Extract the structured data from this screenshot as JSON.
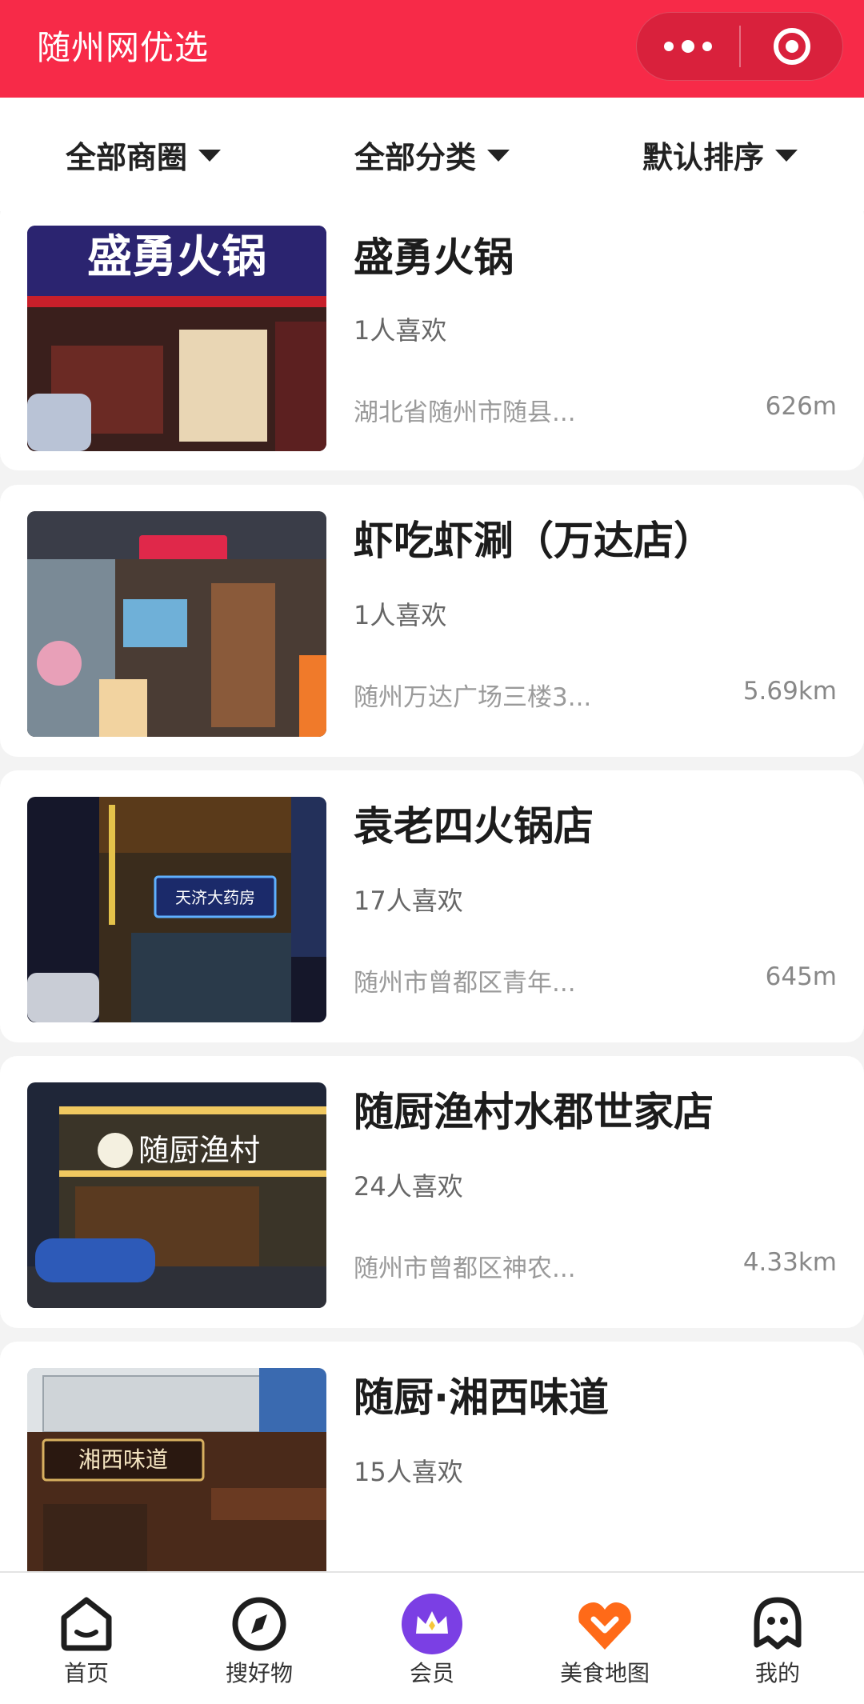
{
  "header": {
    "title": "随州网优选",
    "more_icon": "more-dots-icon",
    "close_icon": "target-close-icon",
    "color": "#f72a48"
  },
  "filters": [
    {
      "label": "全部商圈"
    },
    {
      "label": "全部分类"
    },
    {
      "label": "默认排序"
    }
  ],
  "shops": [
    {
      "name": "盛勇火锅",
      "likes": "1人喜欢",
      "address": "湖北省随州市随县...",
      "distance": "626m"
    },
    {
      "name": "虾吃虾涮（万达店）",
      "likes": "1人喜欢",
      "address": "随州万达广场三楼3...",
      "distance": "5.69km"
    },
    {
      "name": "袁老四火锅店",
      "likes": "17人喜欢",
      "address": "随州市曾都区青年...",
      "distance": "645m"
    },
    {
      "name": "随厨渔村水郡世家店",
      "likes": "24人喜欢",
      "address": "随州市曾都区神农...",
      "distance": "4.33km"
    },
    {
      "name": "随厨·湘西味道",
      "likes": "15人喜欢",
      "address": "",
      "distance": ""
    }
  ],
  "thumb_signs": {
    "shop0": "盛勇火锅",
    "shop2": "天济大药房",
    "shop3": "随厨渔村",
    "shop4": "湘西味道"
  },
  "tabs": [
    {
      "label": "首页",
      "icon": "home-icon"
    },
    {
      "label": "搜好物",
      "icon": "compass-icon"
    },
    {
      "label": "会员",
      "icon": "crown-icon"
    },
    {
      "label": "美食地图",
      "icon": "heart-chevron-icon"
    },
    {
      "label": "我的",
      "icon": "ghost-profile-icon"
    }
  ],
  "colors": {
    "accent": "#f72a48",
    "member": "#7b3fe4",
    "food_map": "#ff6a18"
  }
}
